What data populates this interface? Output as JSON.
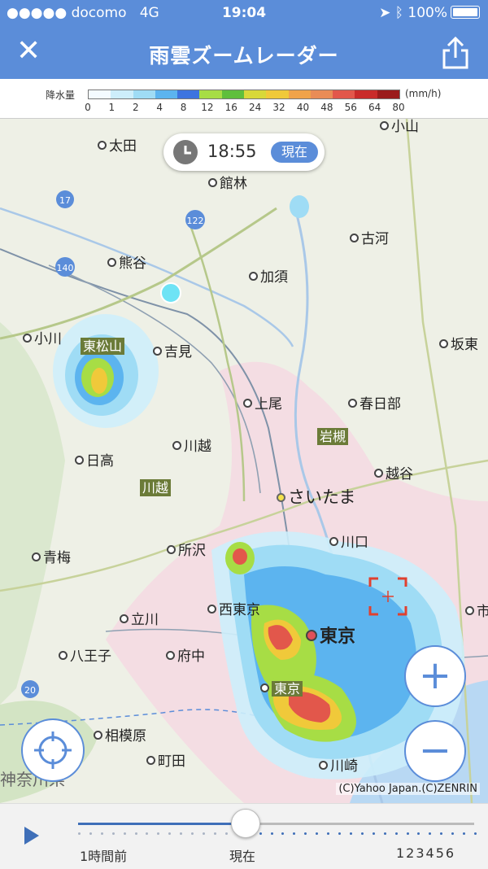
{
  "status_bar": {
    "signal": "●●●●● docomo",
    "network": "4G",
    "time": "19:04",
    "battery": "100%"
  },
  "nav": {
    "close_icon": "close-icon",
    "title": "雨雲ズームレーダー",
    "share_icon": "share-icon"
  },
  "legend": {
    "label": "降水量",
    "unit": "(mm/h)",
    "ticks": [
      "0",
      "1",
      "2",
      "4",
      "8",
      "12",
      "16",
      "24",
      "32",
      "40",
      "48",
      "56",
      "64",
      "80"
    ],
    "colors": [
      "#f4fbff",
      "#cdeefb",
      "#9fdcf5",
      "#5cb4ef",
      "#3d74e0",
      "#a7dd45",
      "#5fbf3c",
      "#d8d83a",
      "#f0c93a",
      "#f0a34a",
      "#e98c56",
      "#e2574b",
      "#c92b2a",
      "#9b1b1b"
    ]
  },
  "time_badge": {
    "time": "18:55",
    "status": "現在"
  },
  "places": [
    {
      "name": "太田",
      "type": "city"
    },
    {
      "name": "小山",
      "type": "city"
    },
    {
      "name": "館林",
      "type": "city"
    },
    {
      "name": "古河",
      "type": "city"
    },
    {
      "name": "熊谷",
      "type": "city"
    },
    {
      "name": "加須",
      "type": "city"
    },
    {
      "name": "小川",
      "type": "city"
    },
    {
      "name": "東松山",
      "type": "station"
    },
    {
      "name": "吉見",
      "type": "city"
    },
    {
      "name": "坂東",
      "type": "city"
    },
    {
      "name": "上尾",
      "type": "city"
    },
    {
      "name": "春日部",
      "type": "city"
    },
    {
      "name": "岩槻",
      "type": "station"
    },
    {
      "name": "日高",
      "type": "city"
    },
    {
      "name": "川越",
      "type": "city"
    },
    {
      "name": "川越",
      "type": "station"
    },
    {
      "name": "越谷",
      "type": "city"
    },
    {
      "name": "さいたま",
      "type": "capital"
    },
    {
      "name": "所沢",
      "type": "city"
    },
    {
      "name": "川口",
      "type": "city"
    },
    {
      "name": "青梅",
      "type": "city"
    },
    {
      "name": "西東京",
      "type": "city"
    },
    {
      "name": "立川",
      "type": "city"
    },
    {
      "name": "東京",
      "type": "capital"
    },
    {
      "name": "八王子",
      "type": "city"
    },
    {
      "name": "府中",
      "type": "city"
    },
    {
      "name": "東京",
      "type": "station"
    },
    {
      "name": "相模原",
      "type": "city"
    },
    {
      "name": "町田",
      "type": "city"
    },
    {
      "name": "川崎",
      "type": "city"
    },
    {
      "name": "神奈川県",
      "type": "region"
    },
    {
      "name": "市",
      "type": "city"
    }
  ],
  "route_labels": [
    "17",
    "122",
    "140",
    "20"
  ],
  "controls": {
    "zoom_in": "+",
    "zoom_out": "−",
    "locate_icon": "crosshair-icon"
  },
  "copyright": "(C)Yahoo Japan.(C)ZENRIN",
  "timeline": {
    "start_label": "1時間前",
    "now_label": "現在",
    "forecast_label": "123456",
    "position_fraction": 0.42
  }
}
